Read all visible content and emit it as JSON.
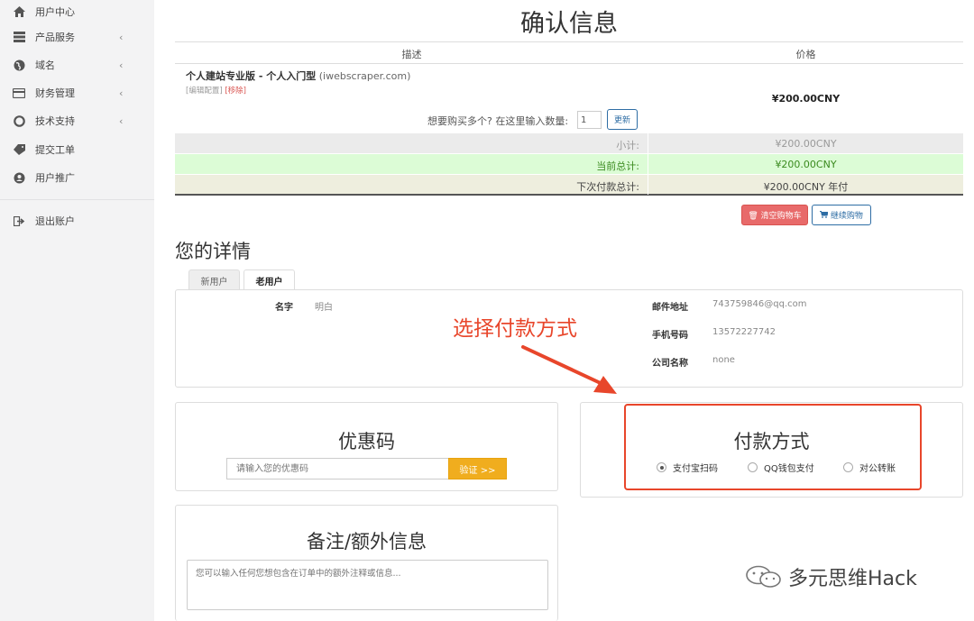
{
  "sidebar": {
    "items": [
      {
        "label": "用户中心",
        "icon": "home-icon",
        "has_submenu": false
      },
      {
        "label": "产品服务",
        "icon": "server-icon",
        "has_submenu": true
      },
      {
        "label": "域名",
        "icon": "globe-icon",
        "has_submenu": true
      },
      {
        "label": "财务管理",
        "icon": "credit-card-icon",
        "has_submenu": true
      },
      {
        "label": "技术支持",
        "icon": "life-ring-icon",
        "has_submenu": true
      },
      {
        "label": "提交工单",
        "icon": "ticket-icon",
        "has_submenu": false
      },
      {
        "label": "用户推广",
        "icon": "user-circle-icon",
        "has_submenu": false
      }
    ],
    "logout": {
      "label": "退出账户",
      "icon": "sign-out-icon"
    },
    "chevron": "‹"
  },
  "page": {
    "title": "确认信息"
  },
  "cart": {
    "headers": {
      "description": "描述",
      "price": "价格"
    },
    "item": {
      "name": "个人建站专业版 - 个人入门型",
      "domain": "(iwebscraper.com)",
      "edit_label": "[编辑配置]",
      "remove_label": "[移除]",
      "price": "¥200.00CNY"
    },
    "quantity": {
      "label": "想要购买多个? 在这里输入数量:",
      "value": "1",
      "update_label": "更新"
    },
    "subtotal": {
      "label": "小计:",
      "value": "¥200.00CNY"
    },
    "current_total": {
      "label": "当前总计:",
      "value": "¥200.00CNY"
    },
    "next_total": {
      "label": "下次付款总计:",
      "value": "¥200.00CNY 年付"
    },
    "empty_label": "清空购物车",
    "continue_label": "继续购物"
  },
  "details": {
    "title": "您的详情",
    "tabs": [
      "新用户",
      "老用户"
    ],
    "active_tab": "老用户",
    "fields": {
      "name_label": "名字",
      "name_value": "明白",
      "email_label": "邮件地址",
      "email_value": "743759846@qq.com",
      "phone_label": "手机号码",
      "phone_value": "13572227742",
      "company_label": "公司名称",
      "company_value": "none"
    }
  },
  "annotation": {
    "text": "选择付款方式",
    "color": "#e8462b"
  },
  "coupon": {
    "title": "优惠码",
    "placeholder": "请输入您的优惠码",
    "button_label": "验证 >>"
  },
  "payment": {
    "title": "付款方式",
    "options": [
      "支付宝扫码",
      "QQ钱包支付",
      "对公转账"
    ],
    "selected": "支付宝扫码"
  },
  "notes": {
    "title": "备注/额外信息",
    "placeholder": "您可以输入任何您想包含在订单中的额外注释或信息..."
  },
  "watermark": {
    "text": "多元思维Hack"
  },
  "colors": {
    "accent_red": "#e8462b",
    "primary_blue": "#2e6da4",
    "danger": "#d9534f",
    "warning": "#f0ad1e",
    "success_bg": "#dcfcd6"
  }
}
